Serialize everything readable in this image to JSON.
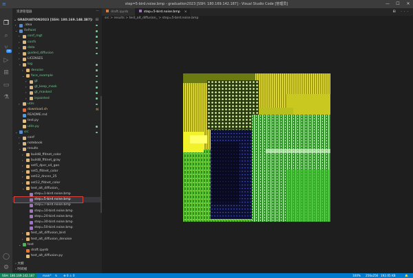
{
  "titlebar": {
    "title": "step=5-bird.noise.bmp - graduation2023 [SSH: 180.169.142.187] - Visual Studio Code [管理员]",
    "minimize": "—",
    "maximize": "☐",
    "close": "✕"
  },
  "activitybar": {
    "scm_badge": "10",
    "items": [
      "explorer",
      "search",
      "source-control",
      "run-debug",
      "extensions",
      "remote-explorer",
      "testing"
    ]
  },
  "sidebar": {
    "header": "资源管理器",
    "ellipsis": "···",
    "root": "GRADUATION2023 [SSH: 180.169.142.187]",
    "root_icons": "⊕ ⊞ ↻ ⊟",
    "tree": [
      {
        "label": ".idea",
        "indent": 0,
        "folder": true,
        "open": false,
        "color": "#cccccc",
        "icon": "#5a89c8",
        "dot": true
      },
      {
        "label": "RePaint",
        "indent": 0,
        "folder": true,
        "open": true,
        "color": "#73c991",
        "icon": "#5a89c8",
        "dot": true
      },
      {
        "label": "conf_mgt",
        "indent": 1,
        "folder": true,
        "open": false,
        "color": "#73c991",
        "icon": "#dcb67a",
        "dot": true
      },
      {
        "label": "confs",
        "indent": 1,
        "folder": true,
        "open": false,
        "color": "#73c991",
        "icon": "#dcb67a",
        "dot": true
      },
      {
        "label": "data",
        "indent": 1,
        "folder": true,
        "open": false,
        "color": "#73c991",
        "icon": "#dcb67a",
        "dot": true
      },
      {
        "label": "guided_diffusion",
        "indent": 1,
        "folder": true,
        "open": false,
        "color": "#73c991",
        "icon": "#dcb67a",
        "dot": true
      },
      {
        "label": "LICENSES",
        "indent": 1,
        "folder": true,
        "open": false,
        "color": "#cccccc",
        "icon": "#dcb67a",
        "dot": false
      },
      {
        "label": "log",
        "indent": 1,
        "folder": true,
        "open": true,
        "color": "#73c991",
        "icon": "#dcb67a",
        "dot": true
      },
      {
        "label": "denoise",
        "indent": 2,
        "folder": true,
        "open": false,
        "color": "#73c991",
        "icon": "#dcb67a",
        "dot": true
      },
      {
        "label": "face_example",
        "indent": 2,
        "folder": true,
        "open": true,
        "color": "#73c991",
        "icon": "#dcb67a",
        "dot": true
      },
      {
        "label": "gt",
        "indent": 3,
        "folder": true,
        "open": false,
        "color": "#73c991",
        "icon": "#dcb67a",
        "dot": true
      },
      {
        "label": "gt_keep_mask",
        "indent": 3,
        "folder": true,
        "open": false,
        "color": "#73c991",
        "icon": "#dcb67a",
        "dot": true
      },
      {
        "label": "gt_masked",
        "indent": 3,
        "folder": true,
        "open": false,
        "color": "#73c991",
        "icon": "#dcb67a",
        "dot": true
      },
      {
        "label": "inpainted",
        "indent": 3,
        "folder": true,
        "open": false,
        "color": "#73c991",
        "icon": "#dcb67a",
        "dot": true
      },
      {
        "label": "utils",
        "indent": 1,
        "folder": true,
        "open": false,
        "color": "#73c991",
        "icon": "#dcb67a",
        "dot": true
      },
      {
        "label": "download.sh",
        "indent": 1,
        "folder": false,
        "color": "#e2c08d",
        "icon": "#e06c3c",
        "badge": "M"
      },
      {
        "label": "README.md",
        "indent": 1,
        "folder": false,
        "color": "#cccccc",
        "icon": "#4e9de0",
        "dot": false
      },
      {
        "label": "test.py",
        "indent": 1,
        "folder": false,
        "color": "#cccccc",
        "icon": "#e5c07b",
        "dot": false
      },
      {
        "label": "utils.py",
        "indent": 1,
        "folder": false,
        "color": "#73c991",
        "icon": "#e5c07b",
        "dot": true
      },
      {
        "label": "src",
        "indent": 0,
        "folder": true,
        "open": true,
        "color": "#73c991",
        "icon": "#5a89c8",
        "dot": true
      },
      {
        "label": "conf",
        "indent": 1,
        "folder": true,
        "open": false,
        "color": "#cccccc",
        "icon": "#dcb67a",
        "dot": false
      },
      {
        "label": "notebook",
        "indent": 1,
        "folder": true,
        "open": false,
        "color": "#cccccc",
        "icon": "#dcb67a",
        "dot": false
      },
      {
        "label": "results",
        "indent": 1,
        "folder": true,
        "open": true,
        "color": "#cccccc",
        "icon": "#dcb67a",
        "dot": false
      },
      {
        "label": "build8_ffdnet_color",
        "indent": 2,
        "folder": true,
        "open": false,
        "color": "#cccccc",
        "icon": "#dcb67a",
        "dot": false
      },
      {
        "label": "build8_ffdnet_gray",
        "indent": 2,
        "folder": true,
        "open": false,
        "color": "#cccccc",
        "icon": "#dcb67a",
        "dot": false
      },
      {
        "label": "set5_dpsr_x4_gan",
        "indent": 2,
        "folder": true,
        "open": false,
        "color": "#cccccc",
        "icon": "#dcb67a",
        "dot": false
      },
      {
        "label": "set5_ffdnet_color",
        "indent": 2,
        "folder": true,
        "open": false,
        "color": "#cccccc",
        "icon": "#dcb67a",
        "dot": false
      },
      {
        "label": "set12_dncnn_25",
        "indent": 2,
        "folder": true,
        "open": false,
        "color": "#cccccc",
        "icon": "#dcb67a",
        "dot": false
      },
      {
        "label": "set12_ffdnet_color",
        "indent": 2,
        "folder": true,
        "open": false,
        "color": "#cccccc",
        "icon": "#dcb67a",
        "dot": false
      },
      {
        "label": "test_alt_diffusion_",
        "indent": 2,
        "folder": true,
        "open": true,
        "color": "#cccccc",
        "icon": "#dcb67a",
        "dot": false
      },
      {
        "label": "step=1-bird.noise.bmp",
        "indent": 3,
        "folder": false,
        "color": "#cccccc",
        "icon": "#a074c4",
        "dot": false
      },
      {
        "label": "step=5-bird.noise.bmp",
        "indent": 3,
        "folder": false,
        "color": "#ffffff",
        "icon": "#a074c4",
        "dot": false,
        "selected": true
      },
      {
        "label": "step=7-bird.noise.bmp",
        "indent": 3,
        "folder": false,
        "color": "#cccccc",
        "icon": "#a074c4",
        "dot": false
      },
      {
        "label": "step=10-bird.noise.bmp",
        "indent": 3,
        "folder": false,
        "color": "#cccccc",
        "icon": "#a074c4",
        "dot": false
      },
      {
        "label": "step=20-bird.noise.bmp",
        "indent": 3,
        "folder": false,
        "color": "#cccccc",
        "icon": "#a074c4",
        "dot": false
      },
      {
        "label": "step=30-bird.noise.bmp",
        "indent": 3,
        "folder": false,
        "color": "#cccccc",
        "icon": "#a074c4",
        "dot": false
      },
      {
        "label": "step=50-bird.noise.bmp",
        "indent": 3,
        "folder": false,
        "color": "#cccccc",
        "icon": "#a074c4",
        "dot": false
      },
      {
        "label": "test_alt_diffusion_bird",
        "indent": 2,
        "folder": true,
        "open": false,
        "color": "#cccccc",
        "icon": "#dcb67a",
        "dot": false
      },
      {
        "label": "test_alt_diffusion_denoise",
        "indent": 2,
        "folder": true,
        "open": false,
        "color": "#cccccc",
        "icon": "#dcb67a",
        "dot": false
      },
      {
        "label": "test",
        "indent": 1,
        "folder": true,
        "open": true,
        "color": "#cccccc",
        "icon": "#4fb05e",
        "dot": false
      },
      {
        "label": "draft.ipynb",
        "indent": 2,
        "folder": false,
        "color": "#cccccc",
        "icon": "#e37933",
        "dot": false
      },
      {
        "label": "test_alt_diffusion.py",
        "indent": 2,
        "folder": false,
        "color": "#cccccc",
        "icon": "#e5c07b",
        "dot": false
      }
    ],
    "outline_label": "大纲",
    "timeline_label": "时间线"
  },
  "tabs": [
    {
      "label": "draft.ipynb",
      "icon": "#e37933",
      "active": false
    },
    {
      "label": "step=5-bird.noise.bmp",
      "icon": "#a074c4",
      "active": true,
      "close": "×"
    }
  ],
  "tab_actions": "⊞ ···",
  "breadcrumb": "src  >  results  >  test_alt_diffusion_  >  step=5-bird.noise.bmp",
  "statusbar": {
    "remote": "SSH: 180.169.142.187",
    "branch": "main*",
    "sync": "↻",
    "problems": "⊗ 0 ⚠ 0",
    "zoom": "100%",
    "dimensions": "256x256",
    "size": "192.05 KB",
    "bell": "🔔"
  }
}
